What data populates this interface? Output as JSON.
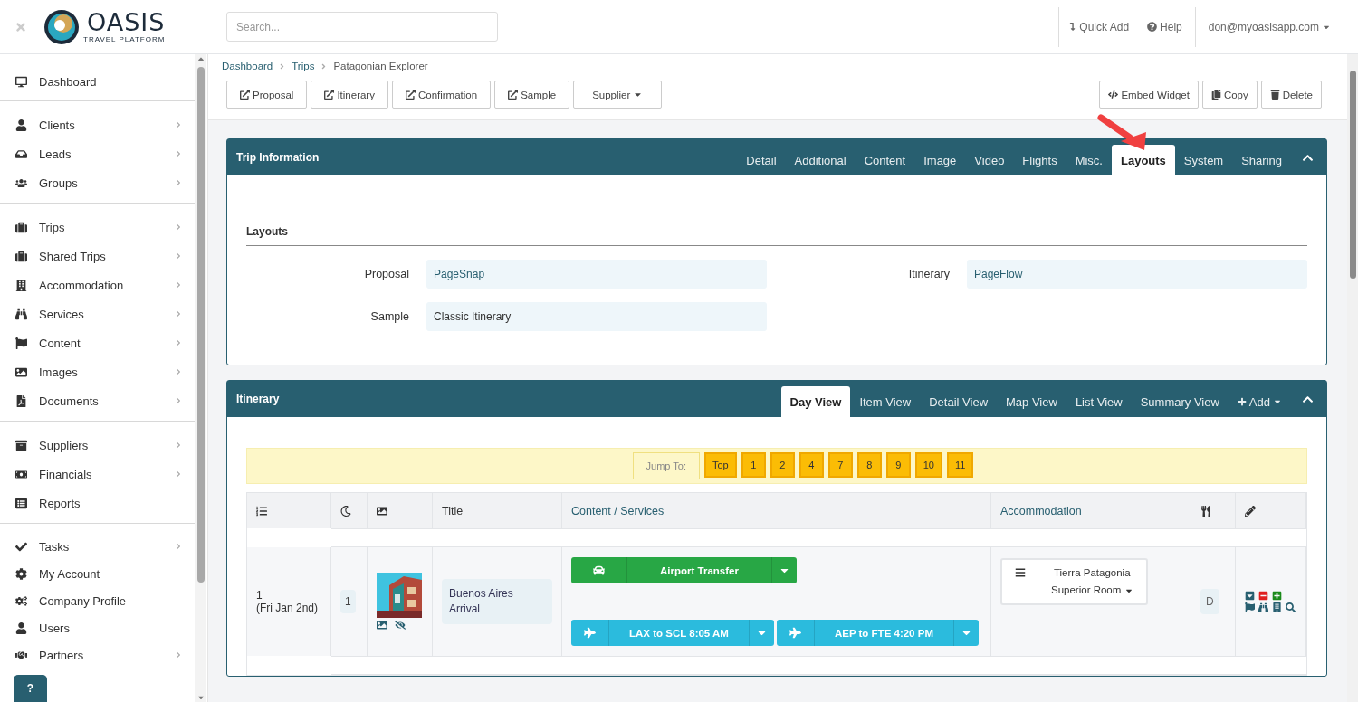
{
  "header": {
    "logo_name": "OASIS",
    "logo_tagline": "TRAVEL PLATFORM",
    "search_placeholder": "Search...",
    "quick_add": "Quick Add",
    "help": "Help",
    "user": "don@myoasisapp.com"
  },
  "sidebar": {
    "groups": [
      [
        {
          "label": "Dashboard",
          "has_children": false
        }
      ],
      [
        {
          "label": "Clients",
          "has_children": true
        },
        {
          "label": "Leads",
          "has_children": true
        },
        {
          "label": "Groups",
          "has_children": true
        }
      ],
      [
        {
          "label": "Trips",
          "has_children": true
        },
        {
          "label": "Shared Trips",
          "has_children": true
        },
        {
          "label": "Accommodation",
          "has_children": true
        },
        {
          "label": "Services",
          "has_children": true
        },
        {
          "label": "Content",
          "has_children": true
        },
        {
          "label": "Images",
          "has_children": true
        },
        {
          "label": "Documents",
          "has_children": true
        }
      ],
      [
        {
          "label": "Suppliers",
          "has_children": true
        },
        {
          "label": "Financials",
          "has_children": true
        },
        {
          "label": "Reports",
          "has_children": false
        }
      ],
      [
        {
          "label": "Tasks",
          "has_children": true
        },
        {
          "label": "My Account",
          "has_children": false
        },
        {
          "label": "Company Profile",
          "has_children": false
        },
        {
          "label": "Users",
          "has_children": false
        },
        {
          "label": "Partners",
          "has_children": true
        }
      ]
    ],
    "help_button": "?"
  },
  "breadcrumb": [
    {
      "label": "Dashboard",
      "link": true
    },
    {
      "label": "Trips",
      "link": true
    },
    {
      "label": "Patagonian Explorer",
      "link": false
    }
  ],
  "actions_left": [
    "Proposal",
    "Itinerary",
    "Confirmation",
    "Sample"
  ],
  "supplier": "Supplier",
  "actions_right": [
    "Embed Widget",
    "Copy",
    "Delete"
  ],
  "trip_info": {
    "title": "Trip Information",
    "tabs": [
      {
        "label": "Detail",
        "selected": false
      },
      {
        "label": "Additional",
        "selected": false
      },
      {
        "label": "Content",
        "selected": false
      },
      {
        "label": "Image",
        "selected": false
      },
      {
        "label": "Video",
        "selected": false
      },
      {
        "label": "Flights",
        "selected": false
      },
      {
        "label": "Misc.",
        "selected": false
      },
      {
        "label": "Layouts",
        "selected": true
      },
      {
        "label": "System",
        "selected": false
      },
      {
        "label": "Sharing",
        "selected": false
      }
    ],
    "section": "Layouts",
    "fields": [
      {
        "label": "Proposal",
        "value": "PageSnap",
        "link": true
      },
      {
        "label": "Itinerary",
        "value": "PageFlow",
        "link": true
      },
      {
        "label": "Sample",
        "value": "Classic Itinerary",
        "link": false
      }
    ]
  },
  "itinerary": {
    "title": "Itinerary",
    "tabs": [
      {
        "label": "Day View",
        "selected": true
      },
      {
        "label": "Item View",
        "selected": false
      },
      {
        "label": "Detail View",
        "selected": false
      },
      {
        "label": "Map View",
        "selected": false
      },
      {
        "label": "List View",
        "selected": false
      },
      {
        "label": "Summary View",
        "selected": false
      }
    ],
    "add": "Add",
    "jump_label": "Jump To:",
    "jumps": [
      "Top",
      "1",
      "2",
      "4",
      "7",
      "8",
      "9",
      "10",
      "11"
    ],
    "columns": [
      "Title",
      "Content / Services",
      "Accommodation"
    ],
    "rows": [
      {
        "day": "1",
        "date": "(Fri Jan 2nd)",
        "nights": "1",
        "title": "Buenos Aires Arrival",
        "services": [
          {
            "kind": "transfer",
            "label": "Airport Transfer"
          },
          {
            "kind": "flight",
            "label": "LAX to SCL 8:05 AM"
          },
          {
            "kind": "flight",
            "label": "AEP to FTE 4:20 PM"
          }
        ],
        "hotel": "Tierra Patagonia",
        "room": "Superior Room",
        "meal": "D"
      }
    ]
  }
}
